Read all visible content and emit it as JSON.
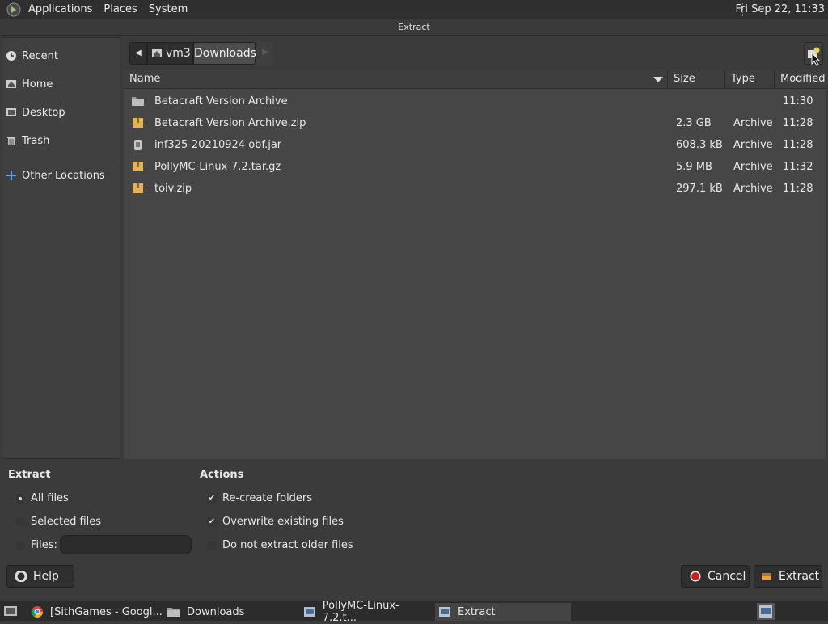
{
  "top_panel": {
    "menus": [
      "Applications",
      "Places",
      "System"
    ],
    "clock": "Fri Sep 22, 11:33"
  },
  "window": {
    "title": "Extract"
  },
  "sidebar": {
    "items": [
      {
        "label": "Recent",
        "icon": "clock-icon"
      },
      {
        "label": "Home",
        "icon": "home-icon"
      },
      {
        "label": "Desktop",
        "icon": "desktop-icon"
      },
      {
        "label": "Trash",
        "icon": "trash-icon"
      },
      {
        "label": "Other Locations",
        "icon": "plus-icon"
      }
    ]
  },
  "pathbar": {
    "segments": [
      "vm3",
      "Downloads"
    ]
  },
  "columns": [
    "Name",
    "Size",
    "Type",
    "Modified"
  ],
  "files": [
    {
      "name": "Betacraft Version Archive",
      "size": "",
      "type": "",
      "modified": "11:30",
      "icon": "folder-icon"
    },
    {
      "name": "Betacraft Version Archive.zip",
      "size": "2.3 GB",
      "type": "Archive",
      "modified": "11:28",
      "icon": "archive-icon"
    },
    {
      "name": "inf325-20210924 obf.jar",
      "size": "608.3 kB",
      "type": "Archive",
      "modified": "11:28",
      "icon": "jar-icon"
    },
    {
      "name": "PollyMC-Linux-7.2.tar.gz",
      "size": "5.9 MB",
      "type": "Archive",
      "modified": "11:32",
      "icon": "archive-icon"
    },
    {
      "name": "toiv.zip",
      "size": "297.1 kB",
      "type": "Archive",
      "modified": "11:28",
      "icon": "archive-icon"
    }
  ],
  "extract_options": {
    "title": "Extract",
    "all_files": "All files",
    "selected_files": "Selected files",
    "files_label": "Files:",
    "files_value": "",
    "selected": "All files"
  },
  "actions": {
    "title": "Actions",
    "recreate_folders": {
      "label": "Re-create folders",
      "checked": true
    },
    "overwrite": {
      "label": "Overwrite existing files",
      "checked": true
    },
    "no_older": {
      "label": "Do not extract older files",
      "checked": false
    }
  },
  "buttons": {
    "help": "Help",
    "cancel": "Cancel",
    "extract": "Extract"
  },
  "taskbar": {
    "tasks": [
      {
        "label": "[SithGames - Googl...",
        "icon": "chrome-icon"
      },
      {
        "label": "Downloads",
        "icon": "folder-icon"
      },
      {
        "label": "PollyMC-Linux-7.2.t...",
        "icon": "archive-manager-icon"
      },
      {
        "label": "Extract",
        "icon": "archive-manager-icon",
        "active": true
      }
    ]
  }
}
